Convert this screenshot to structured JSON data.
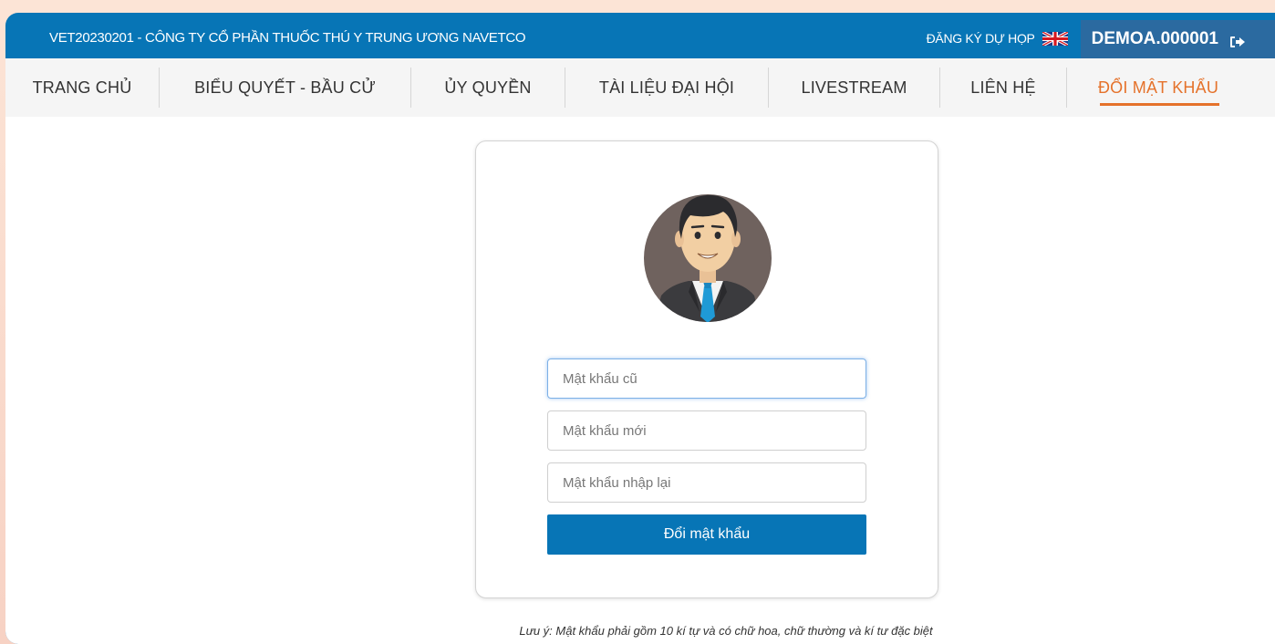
{
  "header": {
    "company_title": "VET20230201 - CÔNG TY CỔ PHẦN THUỐC THÚ Y TRUNG ƯƠNG NAVETCO",
    "register_label": "ĐĂNG KÝ DỰ HỌP",
    "username": "DEMOA.000001",
    "flag_icon": "uk-flag-icon",
    "logout_icon": "sign-out-icon"
  },
  "nav": {
    "items": [
      {
        "label": "TRANG CHỦ"
      },
      {
        "label": "BIỂU QUYẾT - BẦU CỬ"
      },
      {
        "label": "ỦY QUYỀN"
      },
      {
        "label": "TÀI LIỆU ĐẠI HỘI"
      },
      {
        "label": "LIVESTREAM"
      },
      {
        "label": "LIÊN HỆ"
      },
      {
        "label": "ĐỔI MẬT KHẨU"
      }
    ],
    "active_index": 6
  },
  "form": {
    "old_password_placeholder": "Mật khẩu cũ",
    "new_password_placeholder": "Mật khẩu mới",
    "confirm_password_placeholder": "Mật khẩu nhập lại",
    "old_password_value": "",
    "new_password_value": "",
    "confirm_password_value": "",
    "submit_label": "Đổi mật khẩu"
  },
  "note": "Lưu ý: Mật khẩu phải gồm 10 kí tự và có chữ hoa, chữ thường và kí tư đặc biệt",
  "colors": {
    "primary": "#0775b6",
    "active_nav": "#e5722b",
    "user_box": "#2b6aa0"
  }
}
